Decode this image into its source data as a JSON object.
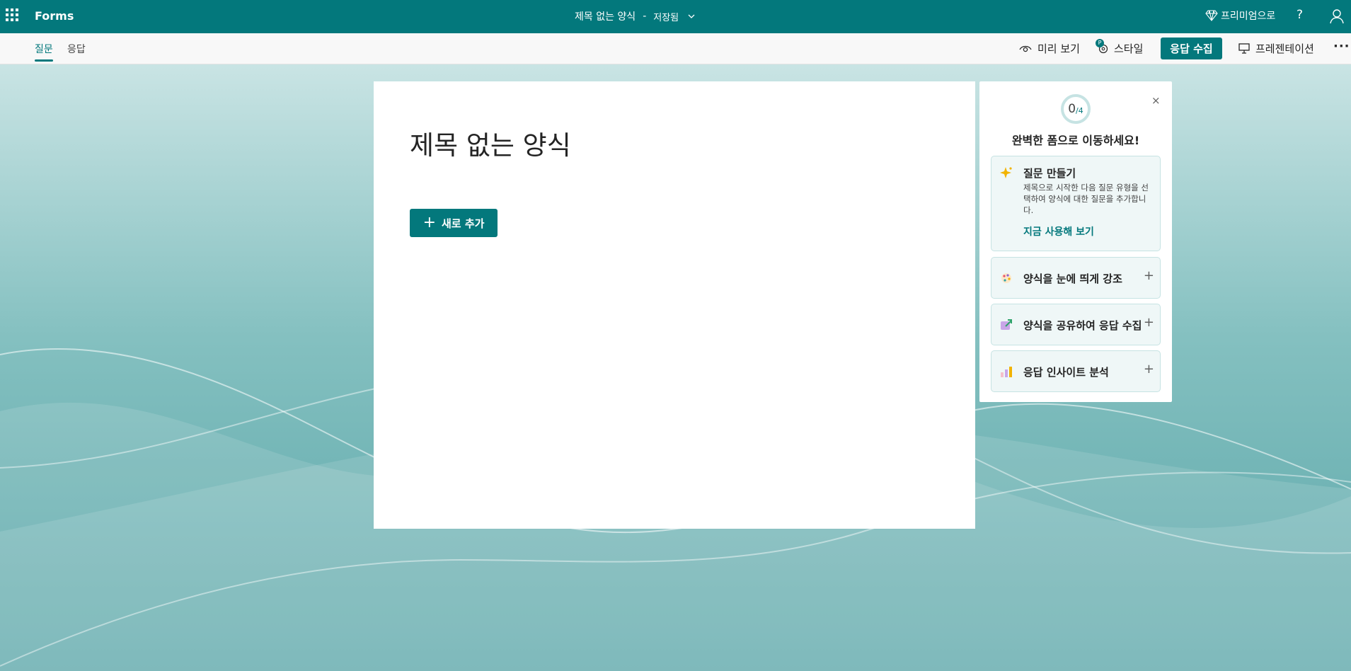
{
  "app": {
    "name": "Forms"
  },
  "document": {
    "title": "제목 없는 양식",
    "separator": "-",
    "status": "저장됨"
  },
  "header": {
    "premium_label": "프리미엄으로",
    "help_label": "?"
  },
  "tabs": [
    {
      "label": "질문",
      "active": true
    },
    {
      "label": "응답",
      "active": false
    }
  ],
  "toolbar": {
    "preview_label": "미리 보기",
    "style_label": "스타일",
    "style_badge": "P",
    "collect_label": "응답 수집",
    "present_label": "프레젠테이션",
    "more_label": "···"
  },
  "form": {
    "title": "제목 없는 양식",
    "add_new_label": "새로 추가",
    "add_new_icon": "plus-icon"
  },
  "panel": {
    "progress_done": "0",
    "progress_total": "/4",
    "progress_fraction": 0,
    "heading": "완벽한 폼으로 이동하세요!",
    "close_label": "×",
    "steps": [
      {
        "title": "질문 만들기",
        "description": "제목으로 시작한 다음 질문 유형을 선택하여 양식에 대한 질문을 추가합니다.",
        "link": "지금 사용해 보기",
        "icon": "sparkle-icon"
      },
      {
        "title": "양식을 눈에 띄게 강조",
        "icon": "palette-icon"
      },
      {
        "title": "양식을 공유하여 응답 수집",
        "icon": "share-icon"
      },
      {
        "title": "응답 인사이트 분석",
        "icon": "insights-icon"
      }
    ]
  },
  "colors": {
    "brand": "#03787c",
    "panel_step_bg": "#eff7f7"
  }
}
